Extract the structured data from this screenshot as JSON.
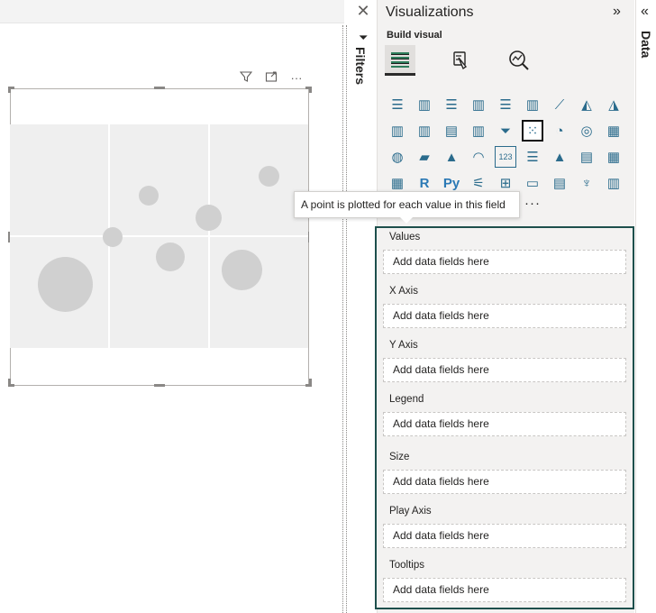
{
  "canvas": {
    "close_glyph": "✕",
    "visual_header": {
      "filter_icon": "filter-icon",
      "focus_icon": "focus-mode-icon",
      "more_glyph": "···"
    }
  },
  "filters": {
    "label": "Filters",
    "icon_glyph": "⏷"
  },
  "visualizations": {
    "title": "Visualizations",
    "collapse_glyph": "»",
    "build_label": "Build visual",
    "tabs": [
      {
        "name": "build-visual",
        "glyph": "▦"
      },
      {
        "name": "format-visual",
        "glyph": "✎"
      },
      {
        "name": "analytics",
        "glyph": "⌕"
      }
    ],
    "icons": [
      {
        "name": "stacked-bar-chart-icon",
        "glyph": "☰"
      },
      {
        "name": "stacked-column-chart-icon",
        "glyph": "▥"
      },
      {
        "name": "clustered-bar-chart-icon",
        "glyph": "☰"
      },
      {
        "name": "clustered-column-chart-icon",
        "glyph": "▥"
      },
      {
        "name": "100-stacked-bar-chart-icon",
        "glyph": "☰"
      },
      {
        "name": "100-stacked-column-chart-icon",
        "glyph": "▥"
      },
      {
        "name": "line-chart-icon",
        "glyph": "⟋"
      },
      {
        "name": "area-chart-icon",
        "glyph": "◭"
      },
      {
        "name": "stacked-area-chart-icon",
        "glyph": "◮"
      },
      {
        "name": "line-and-stacked-column-icon",
        "glyph": "▥"
      },
      {
        "name": "line-and-clustered-column-icon",
        "glyph": "▥"
      },
      {
        "name": "ribbon-chart-icon",
        "glyph": "▤"
      },
      {
        "name": "waterfall-chart-icon",
        "glyph": "▥"
      },
      {
        "name": "funnel-icon",
        "glyph": "⏷"
      },
      {
        "name": "scatter-chart-icon",
        "glyph": "⁙",
        "selected": true
      },
      {
        "name": "pie-chart-icon",
        "glyph": "◔"
      },
      {
        "name": "donut-chart-icon",
        "glyph": "◎"
      },
      {
        "name": "treemap-icon",
        "glyph": "▦"
      },
      {
        "name": "map-icon",
        "glyph": "◍"
      },
      {
        "name": "filled-map-icon",
        "glyph": "▰"
      },
      {
        "name": "azure-map-icon",
        "glyph": "▲"
      },
      {
        "name": "gauge-icon",
        "glyph": "◠"
      },
      {
        "name": "card-icon",
        "glyph": "123"
      },
      {
        "name": "multi-row-card-icon",
        "glyph": "☰"
      },
      {
        "name": "kpi-icon",
        "glyph": "▲"
      },
      {
        "name": "slicer-icon",
        "glyph": "▤"
      },
      {
        "name": "table-icon",
        "glyph": "▦"
      },
      {
        "name": "matrix-icon",
        "glyph": "▦"
      },
      {
        "name": "r-visual-icon",
        "glyph": "R"
      },
      {
        "name": "python-visual-icon",
        "glyph": "Py"
      },
      {
        "name": "key-influencers-icon",
        "glyph": "⚟"
      },
      {
        "name": "decomposition-tree-icon",
        "glyph": "⊞"
      },
      {
        "name": "qa-icon",
        "glyph": "▭"
      },
      {
        "name": "smart-narrative-icon",
        "glyph": "▤"
      },
      {
        "name": "metrics-icon",
        "glyph": "♆"
      },
      {
        "name": "paginated-report-icon",
        "glyph": "▥"
      }
    ],
    "more_glyph": "···",
    "tooltip": "A point is plotted for each value in this field",
    "wells": [
      {
        "label": "Values",
        "placeholder": "Add data fields here"
      },
      {
        "label": "X Axis",
        "placeholder": "Add data fields here"
      },
      {
        "label": "Y Axis",
        "placeholder": "Add data fields here"
      },
      {
        "label": "Legend",
        "placeholder": "Add data fields here"
      },
      {
        "label": "Size",
        "placeholder": "Add data fields here"
      },
      {
        "label": "Play Axis",
        "placeholder": "Add data fields here"
      },
      {
        "label": "Tooltips",
        "placeholder": "Add data fields here"
      }
    ]
  },
  "data_pane": {
    "label": "Data",
    "collapse_glyph": "«"
  }
}
